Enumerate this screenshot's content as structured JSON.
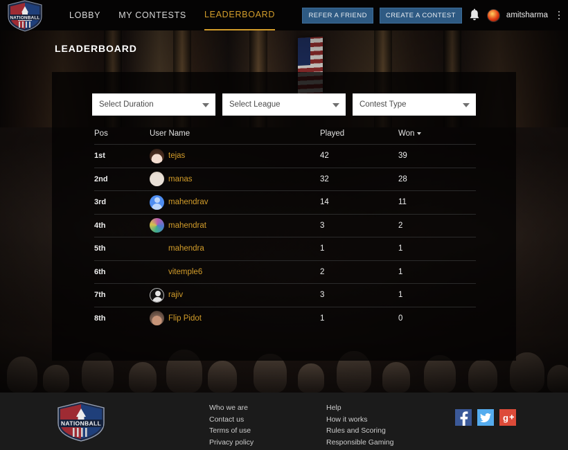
{
  "topnav": {
    "logo_alt": "NATIONBALL",
    "links": [
      {
        "label": "LOBBY",
        "active": false
      },
      {
        "label": "MY CONTESTS",
        "active": false
      },
      {
        "label": "LEADERBOARD",
        "active": true
      }
    ],
    "refer_label": "REFER A FRIEND",
    "create_label": "CREATE A CONTEST",
    "username": "amitsharma",
    "accent_color": "#d39d2a",
    "button_color": "#2e5a83"
  },
  "page": {
    "title": "LEADERBOARD"
  },
  "filters": [
    {
      "name": "duration",
      "value": "Select Duration"
    },
    {
      "name": "league",
      "value": "Select League"
    },
    {
      "name": "contest_type",
      "value": "Contest Type"
    }
  ],
  "table": {
    "headers": {
      "pos": "Pos",
      "user": "User Name",
      "played": "Played",
      "won": "Won"
    },
    "sorted_by": "Won",
    "rows": [
      {
        "pos": "1st",
        "user": "tejas",
        "played": "42",
        "won": "39",
        "avatar": "av-tejas"
      },
      {
        "pos": "2nd",
        "user": "manas",
        "played": "32",
        "won": "28",
        "avatar": "av-manas"
      },
      {
        "pos": "3rd",
        "user": "mahendrav",
        "played": "14",
        "won": "11",
        "avatar": "av-mahendrav"
      },
      {
        "pos": "4th",
        "user": "mahendrat",
        "played": "3",
        "won": "2",
        "avatar": "av-mahendrat"
      },
      {
        "pos": "5th",
        "user": "mahendra",
        "played": "1",
        "won": "1",
        "avatar": ""
      },
      {
        "pos": "6th",
        "user": "vitemple6",
        "played": "2",
        "won": "1",
        "avatar": ""
      },
      {
        "pos": "7th",
        "user": "rajiv",
        "played": "3",
        "won": "1",
        "avatar": "av-rajiv"
      },
      {
        "pos": "8th",
        "user": "Flip Pidot",
        "played": "1",
        "won": "0",
        "avatar": "av-flip"
      }
    ]
  },
  "footer": {
    "logo_alt": "NATIONBALL",
    "col1": [
      "Who we are",
      "Contact us",
      "Terms of use",
      "Privacy policy"
    ],
    "col2": [
      "Help",
      "How it works",
      "Rules and Scoring",
      "Responsible Gaming"
    ],
    "socials": [
      {
        "name": "facebook",
        "glyph": "f",
        "color": "#3b5998"
      },
      {
        "name": "twitter",
        "glyph": "t",
        "color": "#55acee"
      },
      {
        "name": "googleplus",
        "glyph": "g",
        "color": "#dd4b39"
      }
    ]
  }
}
